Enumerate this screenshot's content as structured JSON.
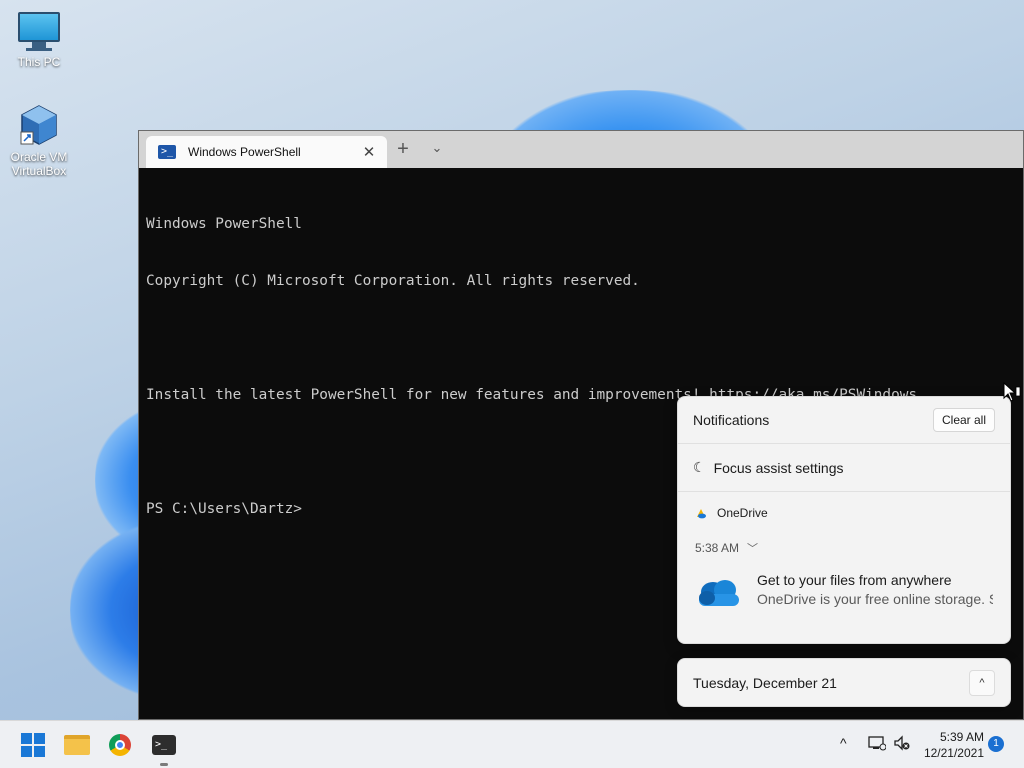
{
  "desktop": {
    "icons": [
      {
        "label": "This PC"
      },
      {
        "label": "Oracle VM VirtualBox"
      }
    ]
  },
  "terminal": {
    "tab_title": "Windows PowerShell",
    "tab_close": "✕",
    "new_tab": "+",
    "dropdown": "⌄",
    "lines": [
      "Windows PowerShell",
      "Copyright (C) Microsoft Corporation. All rights reserved.",
      "",
      "Install the latest PowerShell for new features and improvements! https://aka.ms/PSWindows",
      "",
      "PS C:\\Users\\Dartz>"
    ]
  },
  "notifications": {
    "title": "Notifications",
    "clear_all": "Clear all",
    "focus_assist": "Focus assist settings",
    "app_name": "OneDrive",
    "time": "5:38 AM",
    "toast_title": "Get to your files from anywhere",
    "toast_body": "OneDrive is your free online storage. S"
  },
  "calendar": {
    "date": "Tuesday, December 21",
    "toggle": "^"
  },
  "taskbar": {
    "time": "5:39 AM",
    "date": "12/21/2021",
    "badge": "1",
    "tray_chevron": "^"
  },
  "colors": {
    "accent": "#1a78d6",
    "terminal_bg": "#0c0c0c",
    "terminal_fg": "#cccccc"
  }
}
